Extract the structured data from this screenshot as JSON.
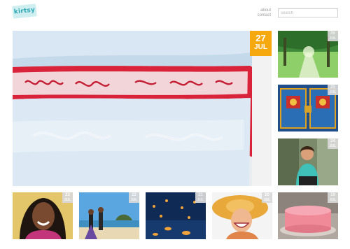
{
  "header": {
    "logo_text": "kirtsy",
    "nav": [
      {
        "label": "about"
      },
      {
        "label": "contact"
      }
    ],
    "search_placeholder": "search"
  },
  "featured": {
    "day": "27",
    "month": "JUL",
    "subject": "embroidered pillowcases"
  },
  "side_posts": [
    {
      "day": "26",
      "month": "JUL",
      "subject": "forest path"
    },
    {
      "day": "25",
      "month": "JUL",
      "subject": "ornate doors"
    },
    {
      "day": "24",
      "month": "JUL",
      "subject": "woman on phone"
    }
  ],
  "bottom_posts": [
    {
      "day": "23",
      "month": "JUL",
      "subject": "smiling woman"
    },
    {
      "day": "22",
      "month": "JUL",
      "subject": "beach couple"
    },
    {
      "day": "21",
      "month": "JUL",
      "subject": "floating lanterns"
    },
    {
      "day": "20",
      "month": "JUL",
      "subject": "woman in sun hat"
    },
    {
      "day": "19",
      "month": "JUL",
      "subject": "pink cake"
    }
  ],
  "colors": {
    "accent": "#f5a90e",
    "badge": "#d9d9d9",
    "logo_bg": "#cfeef0",
    "logo_text": "#2fa7b5"
  }
}
